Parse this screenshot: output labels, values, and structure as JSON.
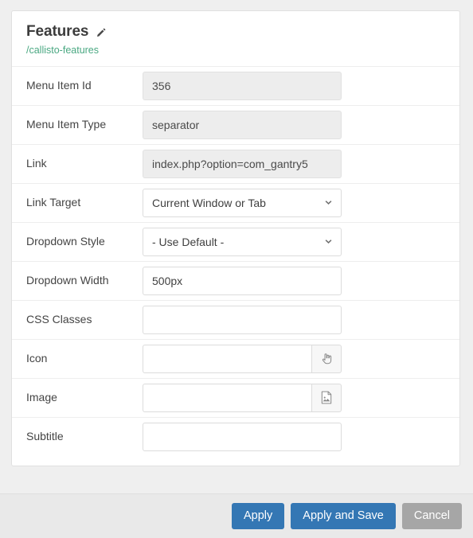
{
  "header": {
    "title": "Features",
    "edit_icon": "pencil-icon",
    "subtitle": "/callisto-features",
    "subtitle_color": "#4aa882"
  },
  "fields": [
    {
      "label": "Menu Item Id",
      "name": "menu-item-id",
      "control": "text",
      "value": "356",
      "placeholder": "",
      "disabled": true
    },
    {
      "label": "Menu Item Type",
      "name": "menu-item-type",
      "control": "text",
      "value": "separator",
      "placeholder": "",
      "disabled": true
    },
    {
      "label": "Link",
      "name": "link",
      "control": "text",
      "value": "index.php?option=com_gantry5",
      "placeholder": "",
      "disabled": true
    },
    {
      "label": "Link Target",
      "name": "link-target",
      "control": "select",
      "value": "Current Window or Tab",
      "icon": "chevron-down-icon",
      "disabled": false
    },
    {
      "label": "Dropdown Style",
      "name": "dropdown-style",
      "control": "select",
      "value": "- Use Default -",
      "icon": "chevron-down-icon",
      "disabled": false
    },
    {
      "label": "Dropdown Width",
      "name": "dropdown-width",
      "control": "text",
      "value": "500px",
      "placeholder": "",
      "disabled": false
    },
    {
      "label": "CSS Classes",
      "name": "css-classes",
      "control": "text",
      "value": "",
      "placeholder": "",
      "disabled": false
    },
    {
      "label": "Icon",
      "name": "icon",
      "control": "text-addon",
      "value": "",
      "placeholder": "",
      "addon_icon": "pointing-hand-icon",
      "disabled": false
    },
    {
      "label": "Image",
      "name": "image",
      "control": "text-addon",
      "value": "",
      "placeholder": "",
      "addon_icon": "picture-icon",
      "disabled": false
    },
    {
      "label": "Subtitle",
      "name": "subtitle",
      "control": "text",
      "value": "",
      "placeholder": "",
      "disabled": false
    }
  ],
  "footer": {
    "apply_label": "Apply",
    "apply_and_save_label": "Apply and Save",
    "cancel_label": "Cancel",
    "primary_color": "#3477b4",
    "cancel_color": "#a6a6a6"
  }
}
